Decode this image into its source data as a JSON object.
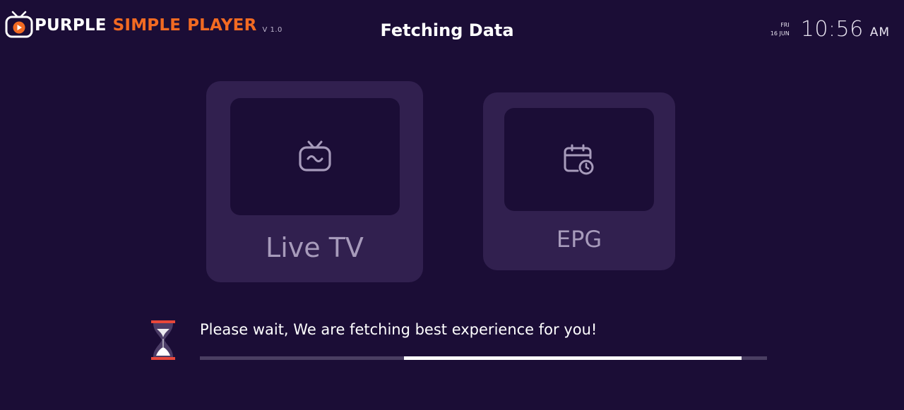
{
  "app": {
    "logo_word_1": "PURPLE",
    "logo_word_2": "SIMPLE",
    "logo_word_3": "PLAYER",
    "version": "V 1.0"
  },
  "header": {
    "title": "Fetching Data"
  },
  "datetime": {
    "day": "FRI",
    "date": "16 JUN",
    "time": "10:56",
    "ampm": "AM"
  },
  "tiles": [
    {
      "label": "Live TV",
      "icon": "tv-icon"
    },
    {
      "label": "EPG",
      "icon": "calendar-clock-icon"
    }
  ],
  "loading": {
    "message": "Please wait, We are fetching best experience for you!",
    "icon": "hourglass-icon",
    "progress_segment_start": 0.36,
    "progress_segment_end": 0.955
  },
  "colors": {
    "background": "#1b0d36",
    "tile": "#31204f",
    "accent": "#f26a22",
    "hourglass_red": "#e8473a",
    "progress_track": "#4a3e62",
    "progress_fill": "#ffffff"
  }
}
